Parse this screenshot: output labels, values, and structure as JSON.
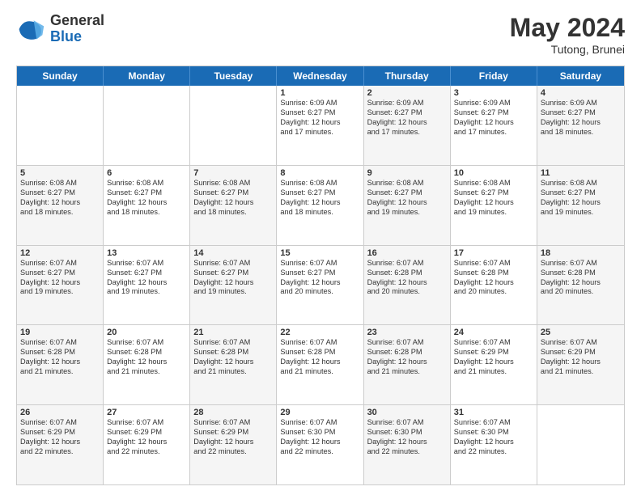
{
  "header": {
    "logo_general": "General",
    "logo_blue": "Blue",
    "month_title": "May 2024",
    "subtitle": "Tutong, Brunei"
  },
  "calendar": {
    "days": [
      "Sunday",
      "Monday",
      "Tuesday",
      "Wednesday",
      "Thursday",
      "Friday",
      "Saturday"
    ],
    "rows": [
      [
        {
          "day": "",
          "lines": [],
          "empty": true
        },
        {
          "day": "",
          "lines": [],
          "empty": true
        },
        {
          "day": "",
          "lines": [],
          "empty": true
        },
        {
          "day": "1",
          "lines": [
            "Sunrise: 6:09 AM",
            "Sunset: 6:27 PM",
            "Daylight: 12 hours",
            "and 17 minutes."
          ],
          "empty": false
        },
        {
          "day": "2",
          "lines": [
            "Sunrise: 6:09 AM",
            "Sunset: 6:27 PM",
            "Daylight: 12 hours",
            "and 17 minutes."
          ],
          "empty": false
        },
        {
          "day": "3",
          "lines": [
            "Sunrise: 6:09 AM",
            "Sunset: 6:27 PM",
            "Daylight: 12 hours",
            "and 17 minutes."
          ],
          "empty": false
        },
        {
          "day": "4",
          "lines": [
            "Sunrise: 6:09 AM",
            "Sunset: 6:27 PM",
            "Daylight: 12 hours",
            "and 18 minutes."
          ],
          "empty": false
        }
      ],
      [
        {
          "day": "5",
          "lines": [
            "Sunrise: 6:08 AM",
            "Sunset: 6:27 PM",
            "Daylight: 12 hours",
            "and 18 minutes."
          ],
          "empty": false
        },
        {
          "day": "6",
          "lines": [
            "Sunrise: 6:08 AM",
            "Sunset: 6:27 PM",
            "Daylight: 12 hours",
            "and 18 minutes."
          ],
          "empty": false
        },
        {
          "day": "7",
          "lines": [
            "Sunrise: 6:08 AM",
            "Sunset: 6:27 PM",
            "Daylight: 12 hours",
            "and 18 minutes."
          ],
          "empty": false
        },
        {
          "day": "8",
          "lines": [
            "Sunrise: 6:08 AM",
            "Sunset: 6:27 PM",
            "Daylight: 12 hours",
            "and 18 minutes."
          ],
          "empty": false
        },
        {
          "day": "9",
          "lines": [
            "Sunrise: 6:08 AM",
            "Sunset: 6:27 PM",
            "Daylight: 12 hours",
            "and 19 minutes."
          ],
          "empty": false
        },
        {
          "day": "10",
          "lines": [
            "Sunrise: 6:08 AM",
            "Sunset: 6:27 PM",
            "Daylight: 12 hours",
            "and 19 minutes."
          ],
          "empty": false
        },
        {
          "day": "11",
          "lines": [
            "Sunrise: 6:08 AM",
            "Sunset: 6:27 PM",
            "Daylight: 12 hours",
            "and 19 minutes."
          ],
          "empty": false
        }
      ],
      [
        {
          "day": "12",
          "lines": [
            "Sunrise: 6:07 AM",
            "Sunset: 6:27 PM",
            "Daylight: 12 hours",
            "and 19 minutes."
          ],
          "empty": false
        },
        {
          "day": "13",
          "lines": [
            "Sunrise: 6:07 AM",
            "Sunset: 6:27 PM",
            "Daylight: 12 hours",
            "and 19 minutes."
          ],
          "empty": false
        },
        {
          "day": "14",
          "lines": [
            "Sunrise: 6:07 AM",
            "Sunset: 6:27 PM",
            "Daylight: 12 hours",
            "and 19 minutes."
          ],
          "empty": false
        },
        {
          "day": "15",
          "lines": [
            "Sunrise: 6:07 AM",
            "Sunset: 6:27 PM",
            "Daylight: 12 hours",
            "and 20 minutes."
          ],
          "empty": false
        },
        {
          "day": "16",
          "lines": [
            "Sunrise: 6:07 AM",
            "Sunset: 6:28 PM",
            "Daylight: 12 hours",
            "and 20 minutes."
          ],
          "empty": false
        },
        {
          "day": "17",
          "lines": [
            "Sunrise: 6:07 AM",
            "Sunset: 6:28 PM",
            "Daylight: 12 hours",
            "and 20 minutes."
          ],
          "empty": false
        },
        {
          "day": "18",
          "lines": [
            "Sunrise: 6:07 AM",
            "Sunset: 6:28 PM",
            "Daylight: 12 hours",
            "and 20 minutes."
          ],
          "empty": false
        }
      ],
      [
        {
          "day": "19",
          "lines": [
            "Sunrise: 6:07 AM",
            "Sunset: 6:28 PM",
            "Daylight: 12 hours",
            "and 21 minutes."
          ],
          "empty": false
        },
        {
          "day": "20",
          "lines": [
            "Sunrise: 6:07 AM",
            "Sunset: 6:28 PM",
            "Daylight: 12 hours",
            "and 21 minutes."
          ],
          "empty": false
        },
        {
          "day": "21",
          "lines": [
            "Sunrise: 6:07 AM",
            "Sunset: 6:28 PM",
            "Daylight: 12 hours",
            "and 21 minutes."
          ],
          "empty": false
        },
        {
          "day": "22",
          "lines": [
            "Sunrise: 6:07 AM",
            "Sunset: 6:28 PM",
            "Daylight: 12 hours",
            "and 21 minutes."
          ],
          "empty": false
        },
        {
          "day": "23",
          "lines": [
            "Sunrise: 6:07 AM",
            "Sunset: 6:28 PM",
            "Daylight: 12 hours",
            "and 21 minutes."
          ],
          "empty": false
        },
        {
          "day": "24",
          "lines": [
            "Sunrise: 6:07 AM",
            "Sunset: 6:29 PM",
            "Daylight: 12 hours",
            "and 21 minutes."
          ],
          "empty": false
        },
        {
          "day": "25",
          "lines": [
            "Sunrise: 6:07 AM",
            "Sunset: 6:29 PM",
            "Daylight: 12 hours",
            "and 21 minutes."
          ],
          "empty": false
        }
      ],
      [
        {
          "day": "26",
          "lines": [
            "Sunrise: 6:07 AM",
            "Sunset: 6:29 PM",
            "Daylight: 12 hours",
            "and 22 minutes."
          ],
          "empty": false
        },
        {
          "day": "27",
          "lines": [
            "Sunrise: 6:07 AM",
            "Sunset: 6:29 PM",
            "Daylight: 12 hours",
            "and 22 minutes."
          ],
          "empty": false
        },
        {
          "day": "28",
          "lines": [
            "Sunrise: 6:07 AM",
            "Sunset: 6:29 PM",
            "Daylight: 12 hours",
            "and 22 minutes."
          ],
          "empty": false
        },
        {
          "day": "29",
          "lines": [
            "Sunrise: 6:07 AM",
            "Sunset: 6:30 PM",
            "Daylight: 12 hours",
            "and 22 minutes."
          ],
          "empty": false
        },
        {
          "day": "30",
          "lines": [
            "Sunrise: 6:07 AM",
            "Sunset: 6:30 PM",
            "Daylight: 12 hours",
            "and 22 minutes."
          ],
          "empty": false
        },
        {
          "day": "31",
          "lines": [
            "Sunrise: 6:07 AM",
            "Sunset: 6:30 PM",
            "Daylight: 12 hours",
            "and 22 minutes."
          ],
          "empty": false
        },
        {
          "day": "",
          "lines": [],
          "empty": true
        }
      ]
    ]
  }
}
